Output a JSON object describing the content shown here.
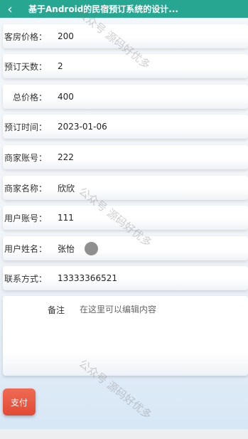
{
  "app_bar": {
    "back_glyph": "‹",
    "title": "基于Android的民宿预订系统的设计..."
  },
  "fields": [
    {
      "label": "客房价格：",
      "value": "200"
    },
    {
      "label": "预订天数：",
      "value": "2"
    },
    {
      "label": "总价格：",
      "value": "400"
    },
    {
      "label": "预订时间：",
      "value": "2023-01-06"
    },
    {
      "label": "商家账号：",
      "value": "222"
    },
    {
      "label": "商家名称：",
      "value": "欣欣"
    },
    {
      "label": "用户账号：",
      "value": "111"
    },
    {
      "label": "用户姓名：",
      "value": "张怡"
    },
    {
      "label": "联系方式：",
      "value": "13333366521"
    }
  ],
  "notes": {
    "label": "备注",
    "placeholder": "在这里可以编辑内容"
  },
  "pay_button": {
    "label": "支付"
  },
  "watermark": {
    "text": "公众号 源码好优多"
  },
  "colors": {
    "app_bar": "#27a791",
    "pay_button": "#e8553f",
    "avatar": "#8f8f8f"
  },
  "icons": {
    "back": "chevron-left-icon",
    "avatar": "avatar-circle"
  }
}
